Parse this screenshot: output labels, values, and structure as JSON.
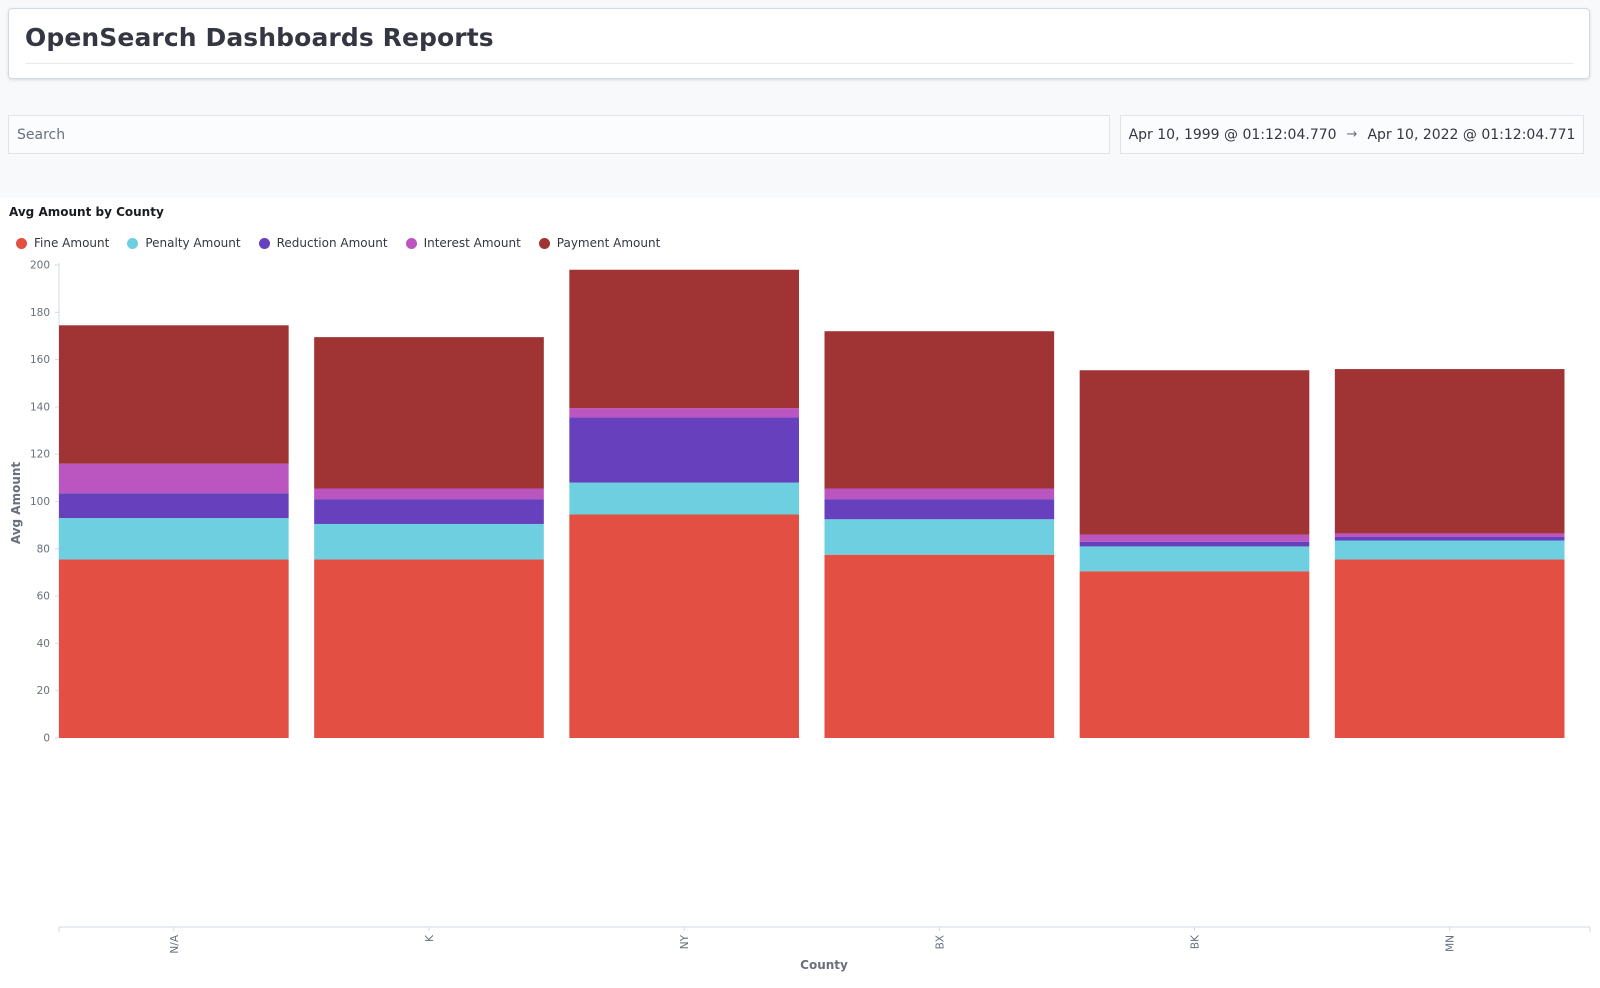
{
  "header": {
    "title": "OpenSearch Dashboards Reports"
  },
  "search": {
    "placeholder": "Search",
    "value": ""
  },
  "date_range": {
    "start": "Apr 10, 1999 @ 01:12:04.770",
    "end": "Apr 10, 2022 @ 01:12:04.771",
    "arrow_icon": "arrow-right-icon"
  },
  "panel": {
    "title": "Avg Amount by County"
  },
  "colors": {
    "fine": "#e34f42",
    "penalty": "#6dcfe0",
    "reduction": "#6640bd",
    "interest": "#bb55c0",
    "payment": "#a03434"
  },
  "chart_data": {
    "type": "bar",
    "stacked": true,
    "title": "Avg Amount by County",
    "xlabel": "County",
    "ylabel": "Avg Amount",
    "ylim": [
      0,
      200
    ],
    "yticks": [
      0,
      20,
      40,
      60,
      80,
      100,
      120,
      140,
      160,
      180,
      200
    ],
    "categories": [
      "N/A",
      "K",
      "NY",
      "BX",
      "BK",
      "MN"
    ],
    "legend_position": "top-left",
    "grid": false,
    "series": [
      {
        "name": "Fine Amount",
        "color": "#e34f42",
        "values": [
          75.5,
          75.5,
          94.5,
          77.5,
          70.5,
          75.5
        ]
      },
      {
        "name": "Penalty Amount",
        "color": "#6dcfe0",
        "values": [
          17.5,
          15,
          13.5,
          15,
          10.5,
          8
        ]
      },
      {
        "name": "Reduction Amount",
        "color": "#6640bd",
        "values": [
          10.5,
          10.5,
          27.5,
          8.5,
          2,
          1.5
        ]
      },
      {
        "name": "Interest Amount",
        "color": "#bb55c0",
        "values": [
          12.5,
          4.5,
          4,
          4.5,
          3,
          1.5
        ]
      },
      {
        "name": "Payment Amount",
        "color": "#a03434",
        "values": [
          58.5,
          64,
          58.5,
          66.5,
          69.5,
          69.5
        ]
      }
    ]
  }
}
